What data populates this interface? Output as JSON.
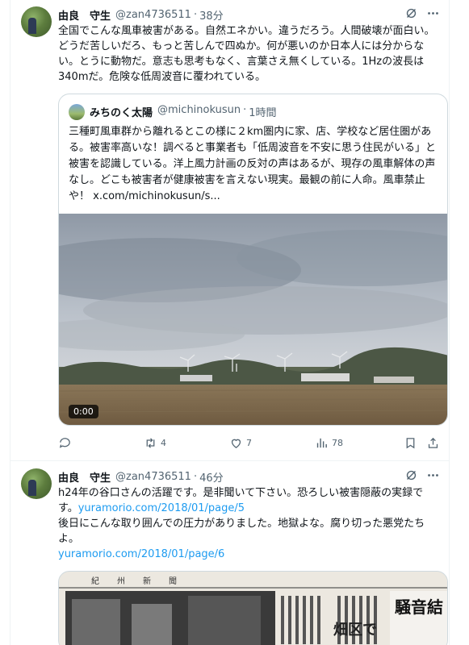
{
  "tweets": [
    {
      "name": "由良　守生",
      "handle": "@zan4736511",
      "time": "38分",
      "text": "全国でこんな風車被害がある。自然エネかい。違うだろう。人間破壊が面白い。どうだ苦しいだろ、もっと苦しんで四ぬか。何が悪いのか日本人には分からない。とうに動物だ。意志も思考もなく、言葉さえ無くしている。1Hzの波長は340mだ。危険な低周波音に覆われている。",
      "quote": {
        "name": "みちのく太陽",
        "handle": "@michinokusun",
        "time": "1時間",
        "text": "三種町風車群から離れるとこの様に２km圏内に家、店、学校など居住圏がある。被害率高いな！調べると事業者も「低周波音を不安に思う住民がいる」と被害を認識している。洋上風力計画の反対の声はあるが、現存の風車解体の声なし。どこも被害者が健康被害を言えない現実。最観の前に人命。風車禁止や！ x.com/michinokusun/s...",
        "duration": "0:00"
      },
      "actions": {
        "replies": "",
        "reposts": "4",
        "likes": "7",
        "views": "78"
      }
    },
    {
      "name": "由良　守生",
      "handle": "@zan4736511",
      "time": "46分",
      "text_1": "h24年の谷口さんの活躍です。是非聞いて下さい。恐ろしい被害隠蔽の実録です。",
      "link_1": "yuramorio.com/2018/01/page/5",
      "text_2": "後日にこんな取り囲んでの圧力がありました。地獄よな。腐り切った悪党たちよ。",
      "link_2": "yuramorio.com/2018/01/page/6",
      "newspaper_text": "紀　州　新　聞",
      "newspaper_headline": "騒音結",
      "newspaper_sub": "畑区で"
    }
  ],
  "icons": {
    "grok": "grok-icon",
    "more": "more-icon",
    "reply": "reply-icon",
    "repost": "repost-icon",
    "like": "like-icon",
    "views": "views-icon",
    "bookmark": "bookmark-icon",
    "share": "share-icon"
  }
}
